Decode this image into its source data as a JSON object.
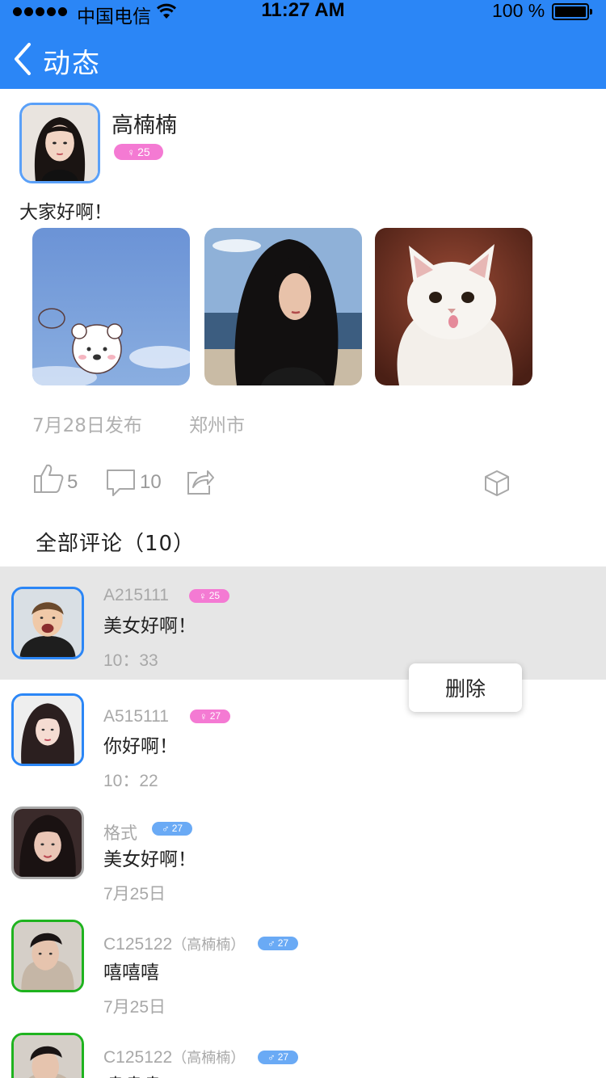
{
  "status_bar": {
    "carrier": "中国电信",
    "time": "11:27 AM",
    "battery": "100 %"
  },
  "nav": {
    "title": "动态"
  },
  "post": {
    "author": "高楠楠",
    "gender": "female",
    "age": "25",
    "text": "大家好啊！",
    "photos": [
      "cartoon-bear-sky-photo",
      "girl-at-beach-photo",
      "white-cat-photo"
    ],
    "date": "7月28日发布",
    "city": "郑州市",
    "likes": "5",
    "comments": "10"
  },
  "comments_header": "全部评论（10）",
  "comments": [
    {
      "user": "A215111",
      "suffix": "",
      "gender": "female",
      "age": "25",
      "text": "美女好啊！",
      "time": "10：33",
      "avatar_border": "#2b86f6"
    },
    {
      "user": "A515111",
      "suffix": "",
      "gender": "female",
      "age": "27",
      "text": "你好啊！",
      "time": "10：22",
      "avatar_border": "#2b86f6"
    },
    {
      "user": "格式",
      "suffix": "",
      "gender": "male",
      "age": "27",
      "text": "美女好啊！",
      "time": "7月25日",
      "avatar_border": "#aaaaaa"
    },
    {
      "user": "C125122",
      "suffix": "（高楠楠）",
      "gender": "male",
      "age": "27",
      "text": "嘻嘻嘻",
      "time": "7月25日",
      "avatar_border": "#1fb31f"
    },
    {
      "user": "C125122",
      "suffix": "（高楠楠）",
      "gender": "male",
      "age": "27",
      "text": "嘻嘻嘻",
      "time": "",
      "avatar_border": "#1fb31f"
    }
  ],
  "context_menu": {
    "delete_label": "删除"
  },
  "colors": {
    "accent": "#2b86f6",
    "female_badge": "#f47ad3",
    "male_badge": "#6aaaf5",
    "highlight_row": "#e6e6e6"
  }
}
